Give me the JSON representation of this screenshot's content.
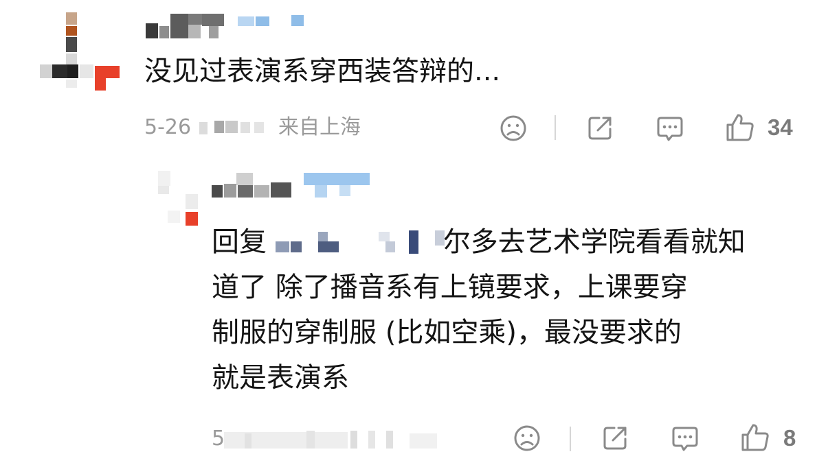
{
  "comment": {
    "text": "没见过表演系穿西装答辩的...",
    "date": "5-26",
    "location": "来自上海",
    "like_count": "34",
    "icons": {
      "dislike": "sad-face-icon",
      "share": "share-icon",
      "comment": "comment-bubble-icon",
      "like": "thumbs-up-icon"
    }
  },
  "reply": {
    "prefix": "回复",
    "lines": [
      "尔多去艺术学院看看就知",
      "道了 除了播音系有上镜要求，上课要穿",
      "制服的穿制服 (比如空乘)，最没要求的",
      "就是表演系"
    ],
    "date": "5",
    "like_count": "8"
  },
  "colors": {
    "text": "#141414",
    "meta": "#9a9a9a",
    "icon": "#8a8a8a",
    "avatar_accent": "#e8402a",
    "name_blue": "#8fbde8"
  }
}
